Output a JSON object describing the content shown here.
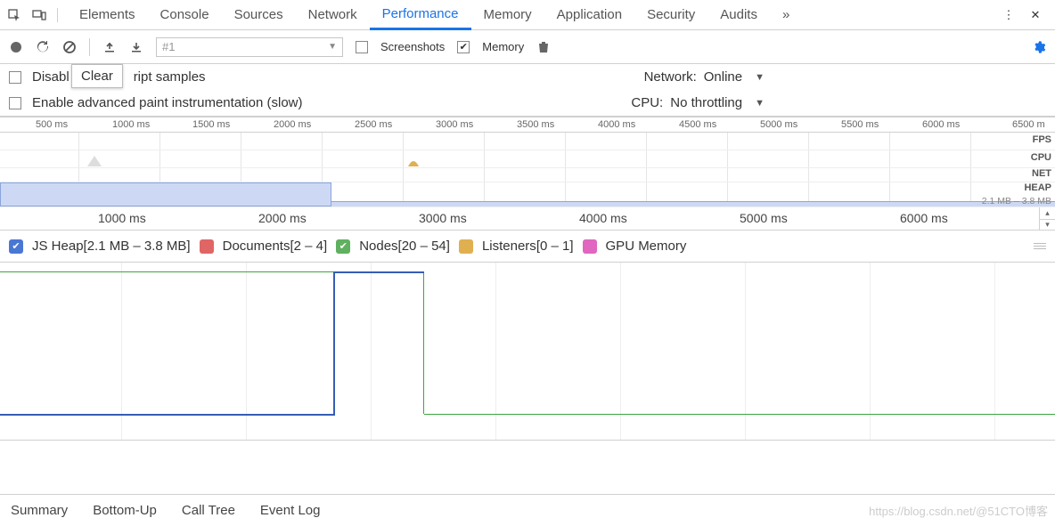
{
  "tabs": [
    "Elements",
    "Console",
    "Sources",
    "Network",
    "Performance",
    "Memory",
    "Application",
    "Security",
    "Audits"
  ],
  "active_tab": "Performance",
  "toolbar": {
    "recording_placeholder": "#1",
    "screenshots_label": "Screenshots",
    "screenshots_checked": false,
    "memory_label": "Memory",
    "memory_checked": true
  },
  "options": {
    "disable_js_label": "Disable JavaScript samples",
    "disable_js_visible_prefix": "Disabl",
    "disable_js_visible_suffix": "ript samples",
    "tooltip": "Clear",
    "advanced_paint_label": "Enable advanced paint instrumentation (slow)",
    "network_label": "Network:",
    "network_value": "Online",
    "cpu_label": "CPU:",
    "cpu_value": "No throttling"
  },
  "overview": {
    "ticks": [
      "500 ms",
      "1000 ms",
      "1500 ms",
      "2000 ms",
      "2500 ms",
      "3000 ms",
      "3500 ms",
      "4000 ms",
      "4500 ms",
      "5000 ms",
      "5500 ms",
      "6000 ms",
      "6500 m"
    ],
    "lane_labels": [
      "FPS",
      "CPU",
      "NET",
      "HEAP"
    ],
    "heap_range": "2.1 MB – 3.8 MB",
    "ticks2": [
      "1000 ms",
      "2000 ms",
      "3000 ms",
      "4000 ms",
      "5000 ms",
      "6000 ms"
    ]
  },
  "legend": {
    "items": [
      {
        "color": "blue",
        "label": "JS Heap",
        "range": "[2.1 MB – 3.8 MB]",
        "checked": true
      },
      {
        "color": "red",
        "label": "Documents",
        "range": "[2 – 4]",
        "checked": false
      },
      {
        "color": "green",
        "label": "Nodes",
        "range": "[20 – 54]",
        "checked": true
      },
      {
        "color": "yellow",
        "label": "Listeners",
        "range": "[0 – 1]",
        "checked": false
      },
      {
        "color": "pink",
        "label": "GPU Memory",
        "range": "",
        "checked": false
      }
    ]
  },
  "bottom_tabs": [
    "Summary",
    "Bottom-Up",
    "Call Tree",
    "Event Log"
  ],
  "watermark": "https://blog.csdn.net/@51CTO博客",
  "chart_data": {
    "type": "line",
    "xlabel": "ms",
    "x_range": [
      0,
      6500
    ],
    "series": [
      {
        "name": "JS Heap (MB)",
        "points": [
          [
            0,
            2.1
          ],
          [
            2100,
            2.1
          ],
          [
            2100,
            3.8
          ],
          [
            2650,
            3.8
          ],
          [
            2650,
            2.1
          ],
          [
            6500,
            2.1
          ]
        ]
      },
      {
        "name": "Nodes",
        "points": [
          [
            0,
            54
          ],
          [
            2100,
            54
          ],
          [
            2100,
            54
          ],
          [
            2650,
            54
          ],
          [
            2650,
            20
          ],
          [
            6500,
            20
          ]
        ]
      }
    ],
    "overview_heap_fill_end_ms": 2050
  }
}
